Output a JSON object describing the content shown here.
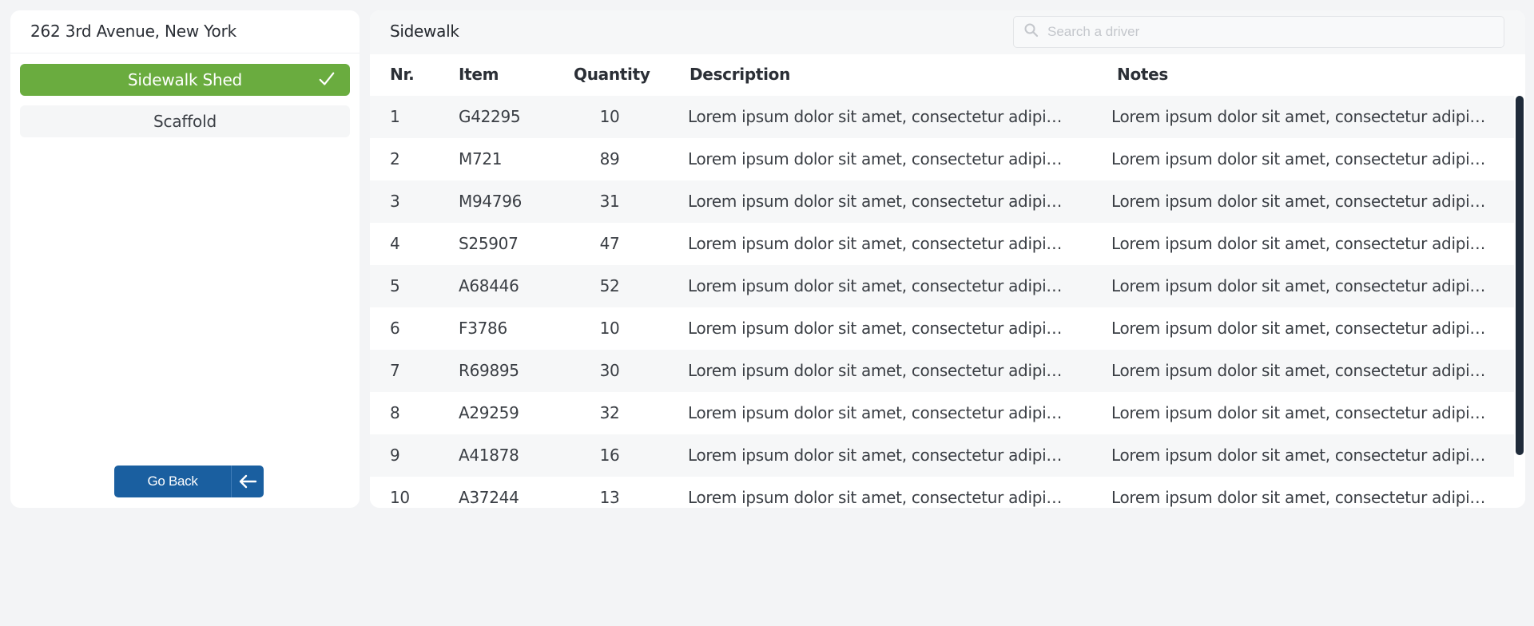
{
  "sidebar": {
    "address": "262 3rd Avenue, New York",
    "categories": [
      {
        "label": "Sidewalk Shed",
        "selected": true
      },
      {
        "label": "Scaffold",
        "selected": false
      }
    ],
    "go_back_label": "Go Back"
  },
  "main": {
    "title": "Sidewalk",
    "search_placeholder": "Search a driver",
    "columns": [
      "Nr.",
      "Item",
      "Quantity",
      "Description",
      "Notes"
    ],
    "rows": [
      {
        "nr": "1",
        "item": "G42295",
        "qty": "10",
        "desc": "Lorem ipsum dolor sit amet, consectetur adipiscing elit",
        "notes": "Lorem ipsum dolor sit amet, consectetur adipiscing elit"
      },
      {
        "nr": "2",
        "item": "M721",
        "qty": "89",
        "desc": "Lorem ipsum dolor sit amet, consectetur adipiscing elit",
        "notes": "Lorem ipsum dolor sit amet, consectetur adipiscing elit"
      },
      {
        "nr": "3",
        "item": "M94796",
        "qty": "31",
        "desc": "Lorem ipsum dolor sit amet, consectetur adipiscing elit",
        "notes": "Lorem ipsum dolor sit amet, consectetur adipiscing elit"
      },
      {
        "nr": "4",
        "item": "S25907",
        "qty": "47",
        "desc": "Lorem ipsum dolor sit amet, consectetur adipiscing elit",
        "notes": "Lorem ipsum dolor sit amet, consectetur adipiscing elit"
      },
      {
        "nr": "5",
        "item": "A68446",
        "qty": "52",
        "desc": "Lorem ipsum dolor sit amet, consectetur adipiscing elit",
        "notes": "Lorem ipsum dolor sit amet, consectetur adipiscing elit"
      },
      {
        "nr": "6",
        "item": "F3786",
        "qty": "10",
        "desc": "Lorem ipsum dolor sit amet, consectetur adipiscing elit",
        "notes": "Lorem ipsum dolor sit amet, consectetur adipiscing elit"
      },
      {
        "nr": "7",
        "item": "R69895",
        "qty": "30",
        "desc": "Lorem ipsum dolor sit amet, consectetur adipiscing elit",
        "notes": "Lorem ipsum dolor sit amet, consectetur adipiscing elit"
      },
      {
        "nr": "8",
        "item": "A29259",
        "qty": "32",
        "desc": "Lorem ipsum dolor sit amet, consectetur adipiscing elit",
        "notes": "Lorem ipsum dolor sit amet, consectetur adipiscing elit"
      },
      {
        "nr": "9",
        "item": "A41878",
        "qty": "16",
        "desc": "Lorem ipsum dolor sit amet, consectetur adipiscing elit",
        "notes": "Lorem ipsum dolor sit amet, consectetur adipiscing elit"
      },
      {
        "nr": "10",
        "item": "A37244",
        "qty": "13",
        "desc": "Lorem ipsum dolor sit amet, consectetur adipiscing elit",
        "notes": "Lorem ipsum dolor sit amet, consectetur adipiscing elit"
      }
    ]
  },
  "colors": {
    "accent_green": "#6aac3f",
    "button_blue": "#1a5fa0",
    "scrollbar": "#1f2b3a"
  }
}
